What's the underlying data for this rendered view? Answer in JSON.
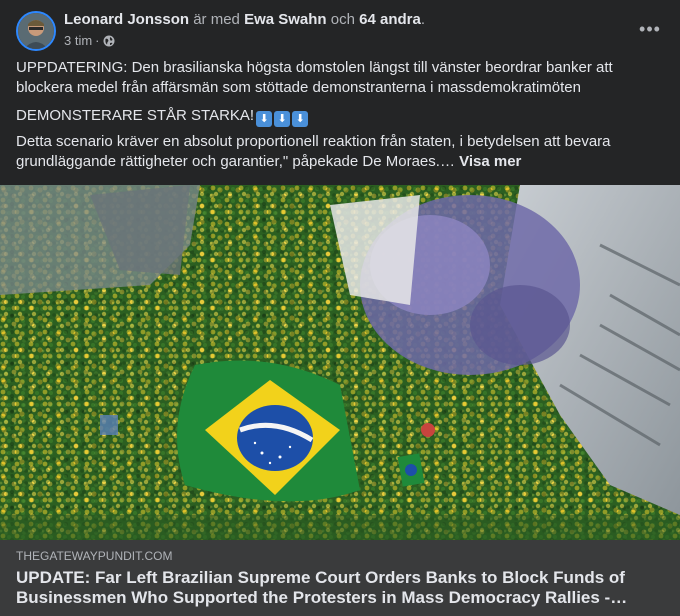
{
  "post": {
    "author": "Leonard Jonsson",
    "with_text": "är med",
    "tagged": "Ewa Swahn",
    "and_text": "och",
    "others": "64 andra",
    "period": ".",
    "time": "3 tim",
    "separator": "·",
    "privacy_icon": "globe-icon",
    "more_label": "•••",
    "paragraph1": "UPPDATERING: Den brasilianska högsta domstolen längst till vänster beordrar banker att blockera medel från affärsmän som stöttade demonstranterna i massdemokratimöten",
    "paragraph2": "DEMONSTERARE STÅR STARKA!",
    "arrow_emoji": "⬇",
    "paragraph3": "Detta scenario kräver en absolut proportionell reaktion från staten, i betydelsen att bevara grundläggande rättigheter och garantier,\" påpekade De Moraes.…",
    "see_more": "Visa mer"
  },
  "link": {
    "domain": "THEGATEWAYPUNDIT.COM",
    "title": "UPDATE: Far Left Brazilian Supreme Court Orders Banks to Block Funds of Businessmen Who Supported the Protesters in Mass Democracy Rallies -…"
  },
  "colors": {
    "background": "#242526",
    "link_box": "#3a3b3c",
    "primary_text": "#e4e6eb",
    "secondary_text": "#b0b3b8",
    "flag_green": "#1f8a3a",
    "flag_yellow": "#f2d21b",
    "flag_blue": "#1d4fa8"
  }
}
